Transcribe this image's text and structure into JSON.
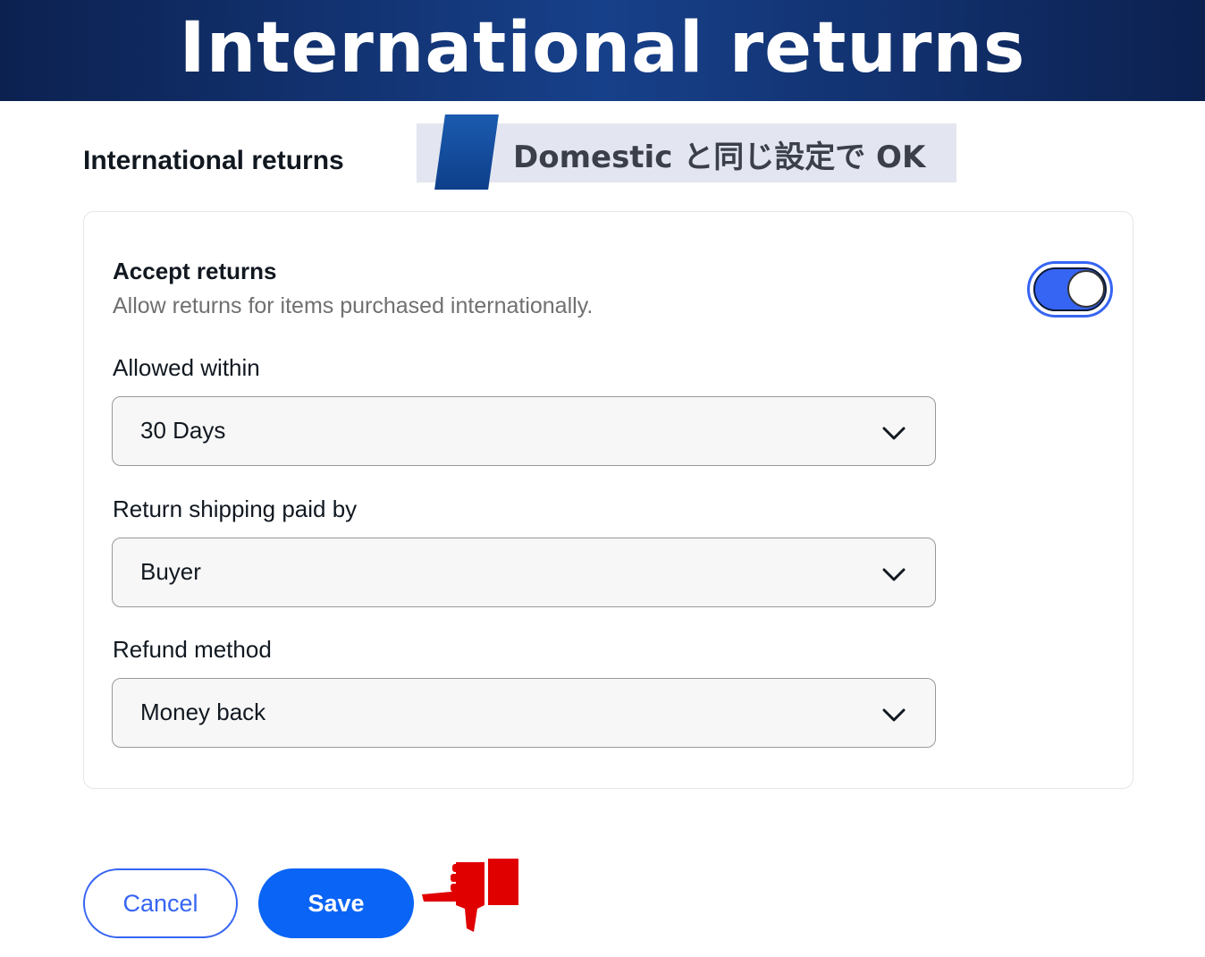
{
  "banner": {
    "title": "International returns"
  },
  "section": {
    "title": "International returns"
  },
  "note": {
    "text": "Domestic と同じ設定で OK"
  },
  "accept_returns": {
    "label": "Accept returns",
    "description": "Allow returns for items purchased internationally.",
    "enabled": true
  },
  "fields": {
    "allowed_within": {
      "label": "Allowed within",
      "value": "30 Days"
    },
    "return_shipping": {
      "label": "Return shipping paid by",
      "value": "Buyer"
    },
    "refund_method": {
      "label": "Refund method",
      "value": "Money back"
    }
  },
  "buttons": {
    "cancel": "Cancel",
    "save": "Save"
  },
  "colors": {
    "banner": "#17408a",
    "accent": "#3665f3",
    "primary_button": "#0a64f5",
    "pointer": "#e00000"
  },
  "icons": {
    "chevron": "chevron-down-icon",
    "pointer": "pointing-hand-icon"
  }
}
